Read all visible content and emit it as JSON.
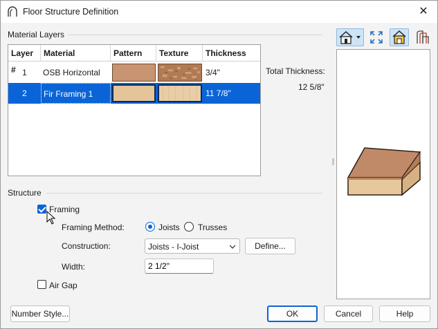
{
  "window": {
    "title": "Floor Structure Definition",
    "close_glyph": "✕"
  },
  "material_layers": {
    "group_label": "Material Layers",
    "columns": [
      "Layer #",
      "Material",
      "Pattern",
      "Texture",
      "Thickness"
    ],
    "rows": [
      {
        "layer": "1",
        "material": "OSB Horizontal",
        "pattern_color": "#c99471",
        "texture_color": "#b07a54",
        "thickness": "3/4\"",
        "selected": false
      },
      {
        "layer": "2",
        "material": "Fir Framing 1",
        "pattern_color": "#e5c49a",
        "texture_color": "#e9cda6",
        "thickness": "11 7/8\"",
        "selected": true
      }
    ],
    "total_label": "Total Thickness:",
    "total_value": "12 5/8\""
  },
  "toolbar": {
    "icons": [
      "house-view-icon",
      "dropdown-arrow-icon",
      "fit-window-icon",
      "color-toggle-icon",
      "layers-preview-icon"
    ]
  },
  "structure": {
    "group_label": "Structure",
    "framing_label": "Framing",
    "framing_checked": true,
    "framing_method_label": "Framing Method:",
    "joists_label": "Joists",
    "trusses_label": "Trusses",
    "framing_method_selected": "Joists",
    "construction_label": "Construction:",
    "construction_value": "Joists - I-Joist",
    "define_button": "Define...",
    "width_label": "Width:",
    "width_value": "2 1/2\"",
    "air_gap_label": "Air Gap",
    "air_gap_checked": false
  },
  "buttons": {
    "number_style": "Number Style...",
    "ok": "OK",
    "cancel": "Cancel",
    "help": "Help"
  },
  "colors": {
    "accent": "#0a64d8",
    "osb": "#c99471",
    "fir": "#e5c49a"
  }
}
